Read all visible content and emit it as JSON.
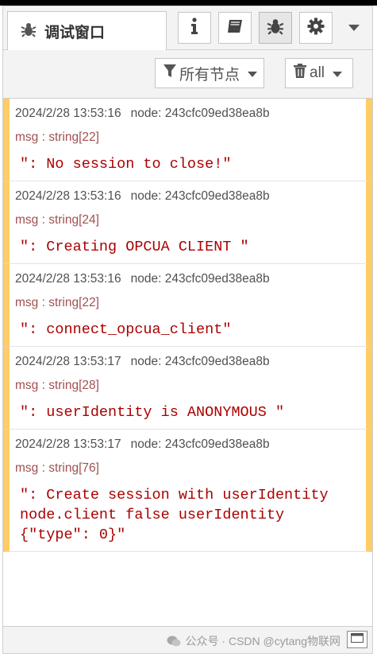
{
  "tab": {
    "label": "调试窗口",
    "icon": "bug-icon"
  },
  "toolbar": [
    {
      "name": "info-icon"
    },
    {
      "name": "book-icon"
    },
    {
      "name": "bug-icon",
      "selected": true
    },
    {
      "name": "gear-icon"
    }
  ],
  "filters": {
    "nodes_label": "所有节点",
    "clear_label": "all"
  },
  "messages": [
    {
      "timestamp": "2024/2/28 13:53:16",
      "node": "node: 243cfc09ed38ea8b",
      "type": "msg : string[22]",
      "payload": "\": No session to close!\""
    },
    {
      "timestamp": "2024/2/28 13:53:16",
      "node": "node: 243cfc09ed38ea8b",
      "type": "msg : string[24]",
      "payload": "\": Creating OPCUA CLIENT \""
    },
    {
      "timestamp": "2024/2/28 13:53:16",
      "node": "node: 243cfc09ed38ea8b",
      "type": "msg : string[22]",
      "payload": "\": connect_opcua_client\""
    },
    {
      "timestamp": "2024/2/28 13:53:17",
      "node": "node: 243cfc09ed38ea8b",
      "type": "msg : string[28]",
      "payload": "\": userIdentity is ANONYMOUS \""
    },
    {
      "timestamp": "2024/2/28 13:53:17",
      "node": "node: 243cfc09ed38ea8b",
      "type": "msg : string[76]",
      "payload": "\": Create session with userIdentity node.client false userIdentity {\"type\": 0}\""
    }
  ],
  "footer": {
    "watermark": "公众号 · CSDN @cytang物联网"
  },
  "colors": {
    "accent": "#ffcc66",
    "payload": "#aa0000",
    "type": "#a05050"
  }
}
